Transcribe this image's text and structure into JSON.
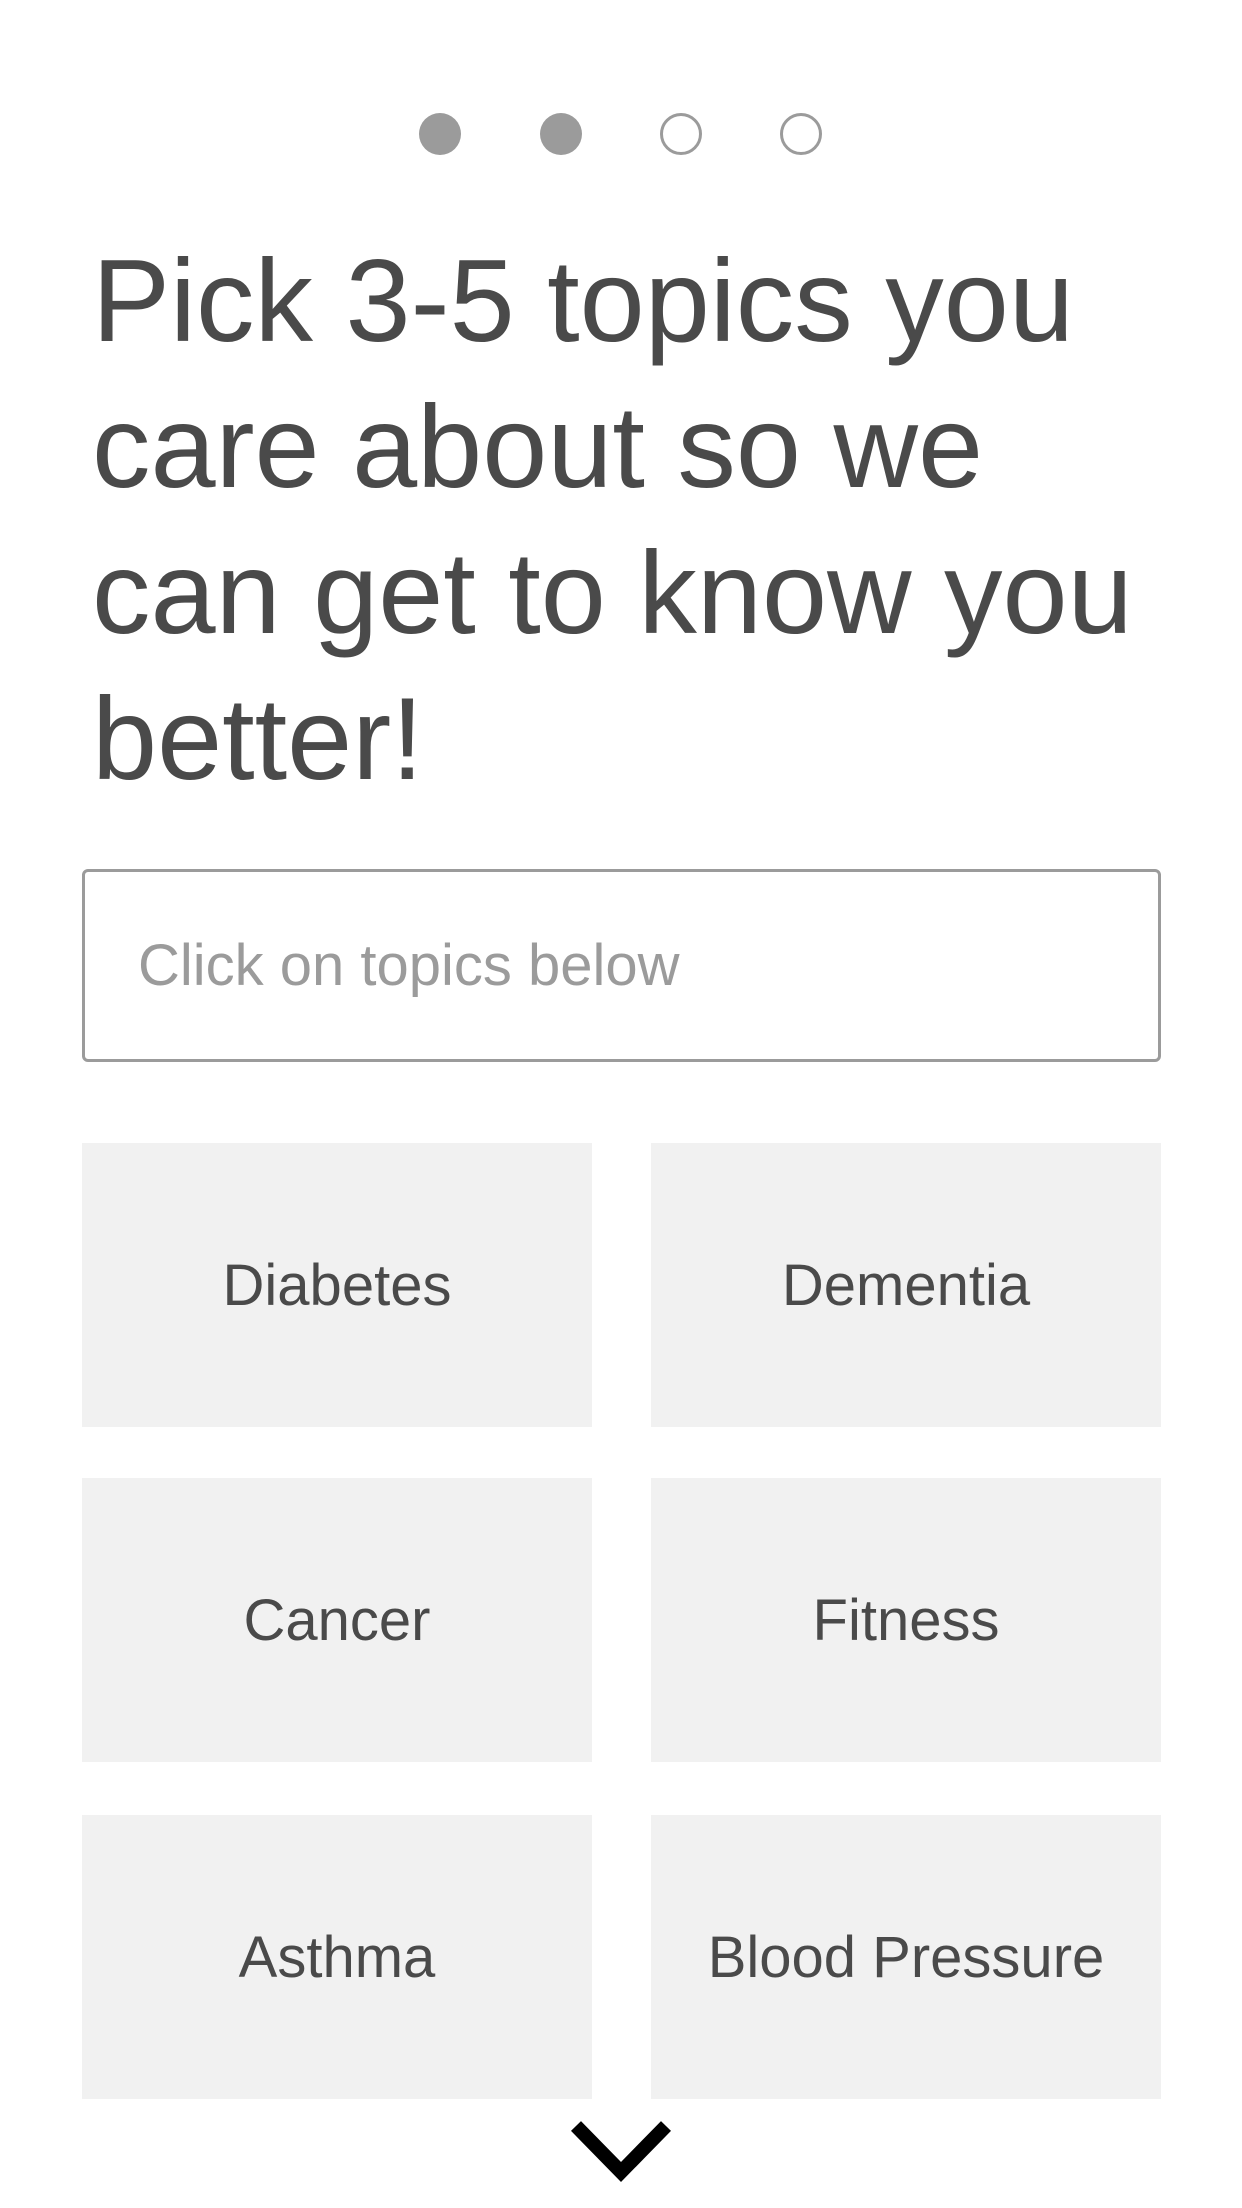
{
  "progress": {
    "total_steps": 4,
    "current_step": 2,
    "dots": [
      {
        "state": "filled"
      },
      {
        "state": "filled"
      },
      {
        "state": "empty"
      },
      {
        "state": "empty"
      }
    ]
  },
  "title": "Pick 3-5 topics you care about so we can get to know you better!",
  "search": {
    "value": "",
    "placeholder": "Click on topics below"
  },
  "topics": [
    {
      "label": "Diabetes"
    },
    {
      "label": "Dementia"
    },
    {
      "label": "Cancer"
    },
    {
      "label": "Fitness"
    },
    {
      "label": "Asthma"
    },
    {
      "label": "Blood Pressure"
    }
  ],
  "scroll_indicator": {
    "icon": "chevron-down-icon"
  },
  "colors": {
    "text": "#4a4a4a",
    "muted": "#9b9b9b",
    "tile_background": "#f1f1f1",
    "background": "#ffffff"
  }
}
